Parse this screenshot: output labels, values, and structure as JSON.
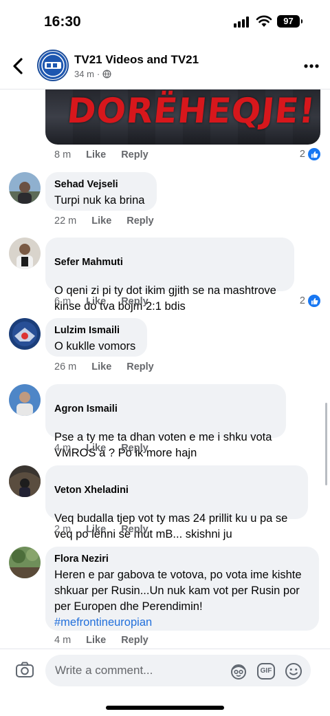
{
  "status": {
    "time": "16:30",
    "battery": "97"
  },
  "header": {
    "title": "TV21 Videos and TV21",
    "time": "34 m",
    "dot": "·"
  },
  "post_image": {
    "overlay_text": "DORËHEQJE!"
  },
  "first_comment_actions": {
    "time": "8 m",
    "like": "Like",
    "reply": "Reply",
    "reactions": "2"
  },
  "comments": [
    {
      "author": "Sehad Vejseli",
      "text": "Turpi nuk ka brina",
      "time": "22 m",
      "like": "Like",
      "reply": "Reply"
    },
    {
      "author": "Sefer Mahmuti",
      "text": "O qeni zi pi ty dot ikim gjith se na mashtrove\nkinse do tva bojm 2:1 bdis",
      "time": "6 m",
      "like": "Like",
      "reply": "Reply",
      "reactions": "2"
    },
    {
      "author": "Lulzim Ismaili",
      "text": "O kuklle vomors",
      "time": "26 m",
      "like": "Like",
      "reply": "Reply"
    },
    {
      "author": "Agron Ismaili",
      "text": "Pse a ty me ta dhan voten e me i shku vota\nVMROS a ? Po ik more hajn",
      "time": "4 m",
      "like": "Like",
      "reply": "Reply"
    },
    {
      "author": "Veton Xheladini",
      "text": "Veq budalla tjep vot ty mas 24 prillit ku u pa se\nveq po lehni se mut mB... skishni ju",
      "time": "2 m",
      "like": "Like",
      "reply": "Reply"
    },
    {
      "author": "Flora Neziri",
      "text": "Heren e par gabova te votova, po vota ime kishte\nshkuar per Rusin...Un nuk kam vot per Rusin por\nper Europen dhe Perendimin!",
      "hashtag": "#mefrontineuropian",
      "time": "4 m",
      "like": "Like",
      "reply": "Reply"
    }
  ],
  "composer": {
    "placeholder": "Write a comment...",
    "gif": "GIF"
  },
  "icons": [
    "back-icon",
    "more-icon",
    "globe-icon",
    "like-icon",
    "camera-icon",
    "avatar-sticker-icon",
    "gif-icon",
    "emoji-icon"
  ],
  "colors": {
    "like_blue": "#1877f2",
    "bubble_bg": "#f0f2f5",
    "meta_gray": "#65676b",
    "hashtag_blue": "#216fdb"
  }
}
